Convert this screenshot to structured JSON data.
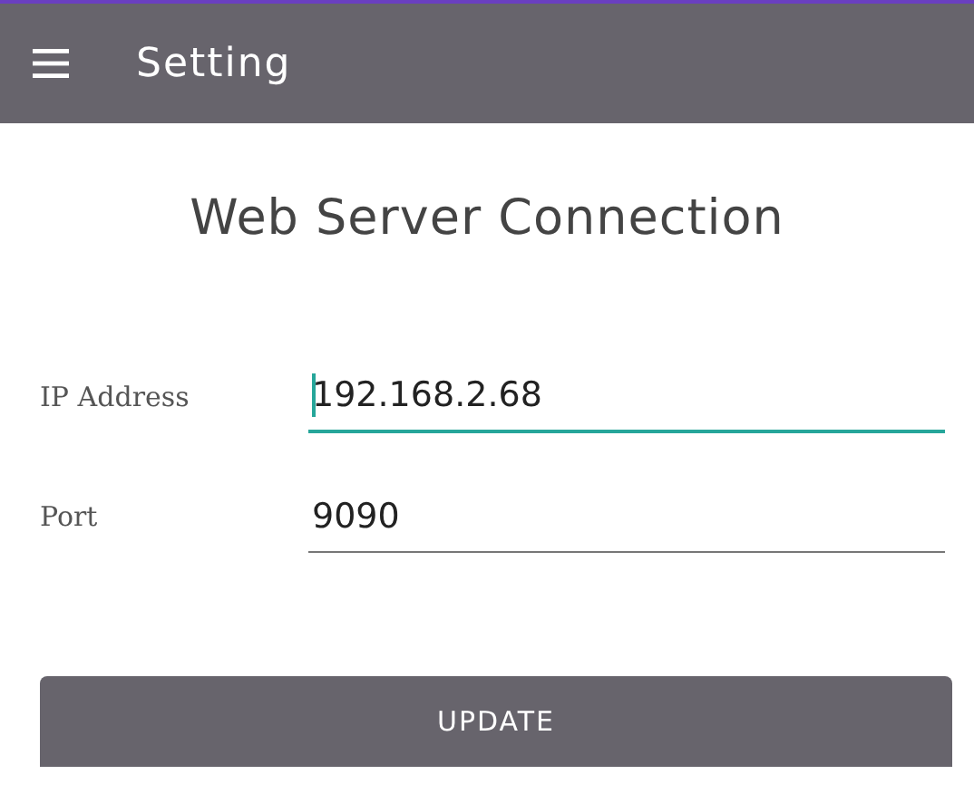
{
  "app_bar": {
    "title": "Setting"
  },
  "heading": "Web Server Connection",
  "fields": [
    {
      "label": "IP Address",
      "value": "192.168.2.68",
      "focused": true
    },
    {
      "label": "Port",
      "value": "9090",
      "focused": false
    }
  ],
  "buttons": [
    {
      "label": "UPDATE"
    }
  ]
}
